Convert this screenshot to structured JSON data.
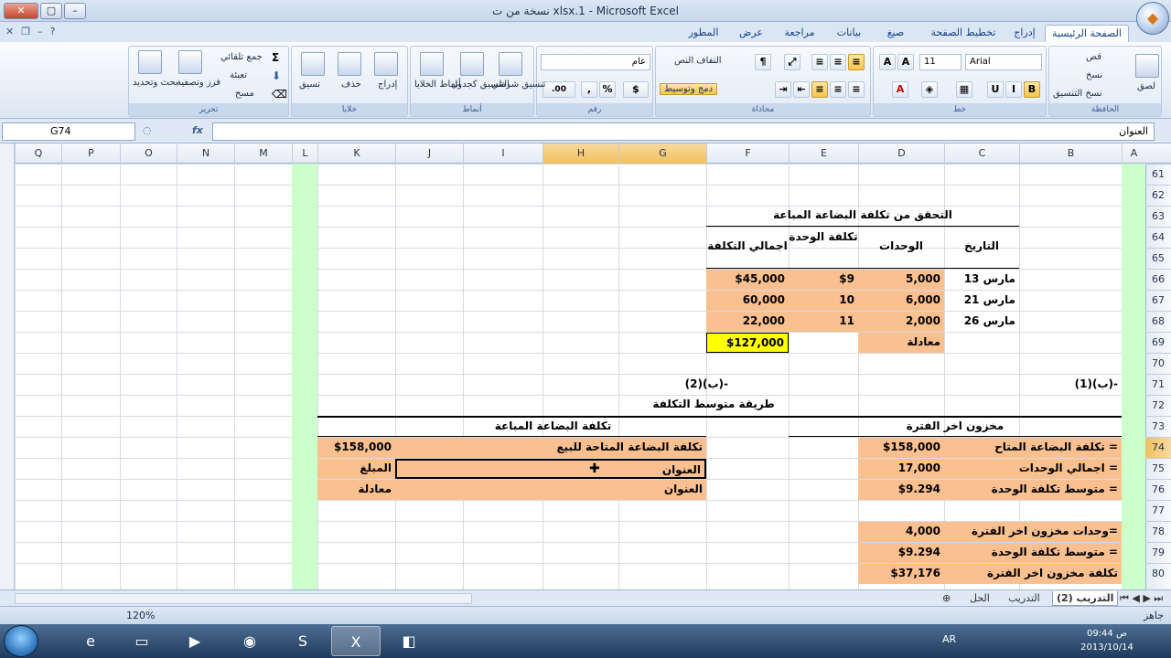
{
  "window": {
    "title": "نسخة من ت xlsx.1 - Microsoft Excel",
    "min_label": "–",
    "max_label": "▢",
    "close_label": "✕"
  },
  "tabs": [
    "الصفحة الرئيسية",
    "إدراج",
    "تخطيط الصفحة",
    "صيغ",
    "بيانات",
    "مراجعة",
    "عرض",
    "المطور"
  ],
  "ribbon": {
    "clipboard": {
      "label": "الحافظة",
      "paste": "لصق",
      "cut": "قص",
      "copy": "نسخ",
      "format_painter": "نسخ التنسيق"
    },
    "font": {
      "label": "خط",
      "font_name": "Arial",
      "font_size": "11"
    },
    "alignment": {
      "label": "محاذاة",
      "wrap": "التفاف النص",
      "merge": "دمج وتوسيط"
    },
    "number": {
      "label": "رقم",
      "format": "عام",
      "currency": "$",
      "percent": "%",
      "comma": ","
    },
    "styles": {
      "label": "أنماط",
      "cond": "تنسيق شرطي",
      "table": "التنسيق كجدول",
      "cell": "أنماط الخلايا"
    },
    "cells": {
      "label": "خلايا",
      "insert": "إدراج",
      "delete": "حذف",
      "format": "تسيق"
    },
    "editing": {
      "label": "تحرير",
      "autosum": "جمع تلقائي",
      "fill": "تعبئة",
      "clear": "مسح",
      "sort": "فرز وتصفية",
      "find": "بحث وتحديد"
    }
  },
  "formula_bar": {
    "name_box": "G74",
    "fx": "fx",
    "content": "العنوان"
  },
  "columns": [
    "A",
    "B",
    "C",
    "D",
    "E",
    "F",
    "G",
    "H",
    "I",
    "J",
    "K",
    "L",
    "M",
    "N",
    "O",
    "P",
    "Q"
  ],
  "selected_column": "H",
  "rows": [
    "61",
    "62",
    "63",
    "64",
    "65",
    "66",
    "67",
    "68",
    "69",
    "70",
    "71",
    "72",
    "73",
    "74",
    "75",
    "76",
    "77",
    "78",
    "79",
    "80"
  ],
  "selected_row": "74",
  "sheet": {
    "verify_title": "التحقق من تكلفة البضاعة المباعة",
    "hdr_date": "التاريخ",
    "hdr_units": "الوحدات",
    "hdr_unit_cost": "تكلفة الوحدة",
    "hdr_total_cost": "اجمالي التكلفة",
    "r65": {
      "date": "مارس 13",
      "units": "5,000",
      "unit_cost": "$9",
      "total": "$45,000"
    },
    "r66": {
      "date": "مارس 21",
      "units": "6,000",
      "unit_cost": "10",
      "total": "60,000"
    },
    "r67": {
      "date": "مارس 26",
      "units": "2,000",
      "unit_cost": "11",
      "total": "22,000"
    },
    "r68": {
      "label": "معادلة",
      "total": "$127,000"
    },
    "part1": "-(ب)(1)",
    "part2": "-(ب)(2)",
    "method": "طريقة متوسط التكلفة",
    "end_inventory": "مخزون اخر الفترة",
    "cogs": "تكلفة البضاعة المباعة",
    "r73": {
      "left_label": "= تكلفة البضاعة المتاح",
      "left_val": "$158,000",
      "right_label": "تكلفة البضاعة المتاحة للبيع",
      "right_val": "$158,000"
    },
    "r74": {
      "left_label": "= اجمالي الوحدات",
      "left_val": "17,000",
      "right_label": "العنوان",
      "right_val": "المبلغ"
    },
    "r75": {
      "left_label": "= متوسط تكلفة الوحدة",
      "left_val": "$9.294",
      "right_label": "العنوان",
      "right_val": "معادلة"
    },
    "r77": {
      "label": "=وحدات مخزون اخر الفترة",
      "val": "4,000"
    },
    "r78": {
      "label": "= متوسط تكلفة الوحدة",
      "val": "$9.294"
    },
    "r79": {
      "label": "تكلفة مخزون اخر الفترة",
      "val": "$37,176"
    }
  },
  "sheet_tabs": [
    "التدريب (2)",
    "التدريب",
    "الحل"
  ],
  "status": {
    "ready": "جاهز",
    "zoom": "120%"
  },
  "taskbar": {
    "lang": "AR",
    "time": "09:44 ص",
    "date": "2013/10/14"
  }
}
